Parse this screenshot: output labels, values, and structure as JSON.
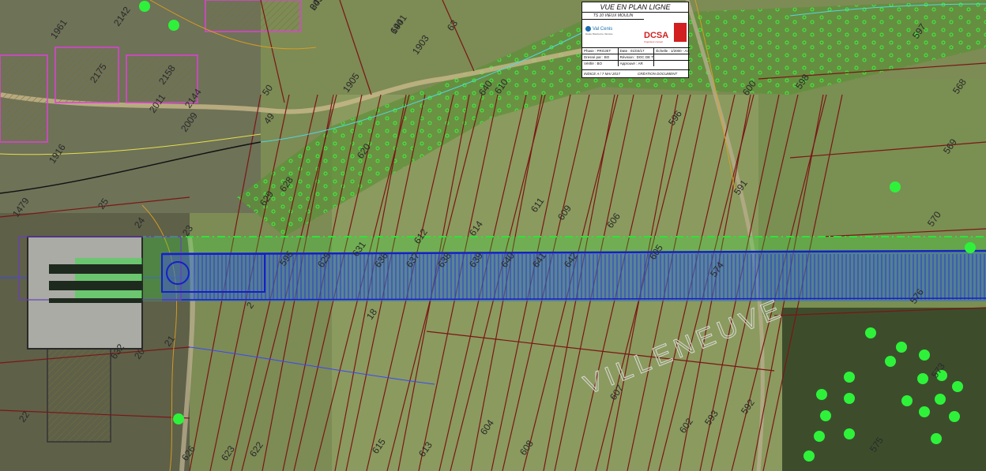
{
  "map": {
    "watermark": "VILLENEUVE",
    "parcels": [
      "2099",
      "1901",
      "63",
      "2142",
      "1961",
      "2175",
      "2011",
      "2158",
      "2144",
      "2009",
      "50",
      "49",
      "1905",
      "1903",
      "640",
      "610",
      "620",
      "629",
      "628",
      "1916",
      "1479",
      "25",
      "24",
      "23",
      "2",
      "622",
      "623",
      "626",
      "632",
      "20",
      "21",
      "22",
      "18",
      "615",
      "613",
      "612",
      "614",
      "611",
      "609",
      "606",
      "605",
      "604",
      "608",
      "607",
      "602",
      "593",
      "592",
      "591",
      "596",
      "600",
      "598",
      "597",
      "568",
      "569",
      "570",
      "573",
      "575",
      "576",
      "574",
      "595",
      "625",
      "631",
      "636",
      "637",
      "638",
      "639",
      "640",
      "641",
      "642",
      "643",
      "644"
    ],
    "green_dots": 24
  },
  "cartouche": {
    "title": "VUE EN PLAN LIGNE",
    "subtitle": "TS 10 VIEUX MOULIN",
    "logo_left": "Val Cenis",
    "logo_left_tag": "Haute Maurienne Vanoise",
    "logo_right": "DCSA",
    "logo_right_tag": "l'ingénieur conseil",
    "rows": [
      [
        "Phase : PROJET",
        "Date : 01/03/17",
        "Échelle : 1/2000 - A3"
      ],
      [
        "Dressé par : BO",
        "Révision : DOC DE TRAVAIL",
        ""
      ],
      [
        "Vérifié : BO",
        "Approuvé : AR",
        ""
      ]
    ],
    "footer": [
      "INDICE A / 7 MAI 2017",
      "CRÉATION DOCUMENT"
    ]
  }
}
